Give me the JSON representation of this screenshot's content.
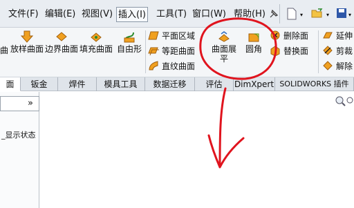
{
  "menubar": {
    "items": [
      "文件(F)",
      "编辑(E)",
      "视图(V)",
      "插入(I)",
      "工具(T)",
      "窗口(W)",
      "帮助(H)"
    ]
  },
  "ribbon": {
    "left_edge_label": "曲",
    "large_buttons": [
      {
        "label": "放样曲面",
        "icon": "loft-surface-icon"
      },
      {
        "label": "边界曲面",
        "icon": "boundary-surface-icon"
      },
      {
        "label": "填充曲面",
        "icon": "fill-surface-icon"
      },
      {
        "label": "自由形",
        "icon": "freeform-icon"
      },
      {
        "label": "曲面展平",
        "icon": "surface-flatten-icon"
      },
      {
        "label": "圆角",
        "icon": "fillet-icon"
      }
    ],
    "small_buttons": [
      {
        "label": "平面区域",
        "icon": "planar-surface-icon"
      },
      {
        "label": "等距曲面",
        "icon": "offset-surface-icon"
      },
      {
        "label": "直纹曲面",
        "icon": "ruled-surface-icon"
      },
      {
        "label": "删除面",
        "icon": "delete-face-icon"
      },
      {
        "label": "替换面",
        "icon": "replace-face-icon"
      },
      {
        "label": "延伸",
        "icon": "extend-surface-icon"
      },
      {
        "label": "剪裁",
        "icon": "trim-surface-icon"
      },
      {
        "label": "解除",
        "icon": "untrim-surface-icon"
      }
    ]
  },
  "tabs": [
    "面",
    "钣金",
    "焊件",
    "模具工具",
    "数据迁移",
    "评估",
    "DimXpert",
    "SOLIDWORKS 插件"
  ],
  "left_panel": {
    "collapse_glyph": "»",
    "display_state_label": "_显示状态"
  },
  "colors": {
    "annotation_red": "#e0141e",
    "menu_bg": "#e9edf2",
    "ribbon_bg": "#f4f6f8",
    "icon_orange": "#f0a020"
  }
}
